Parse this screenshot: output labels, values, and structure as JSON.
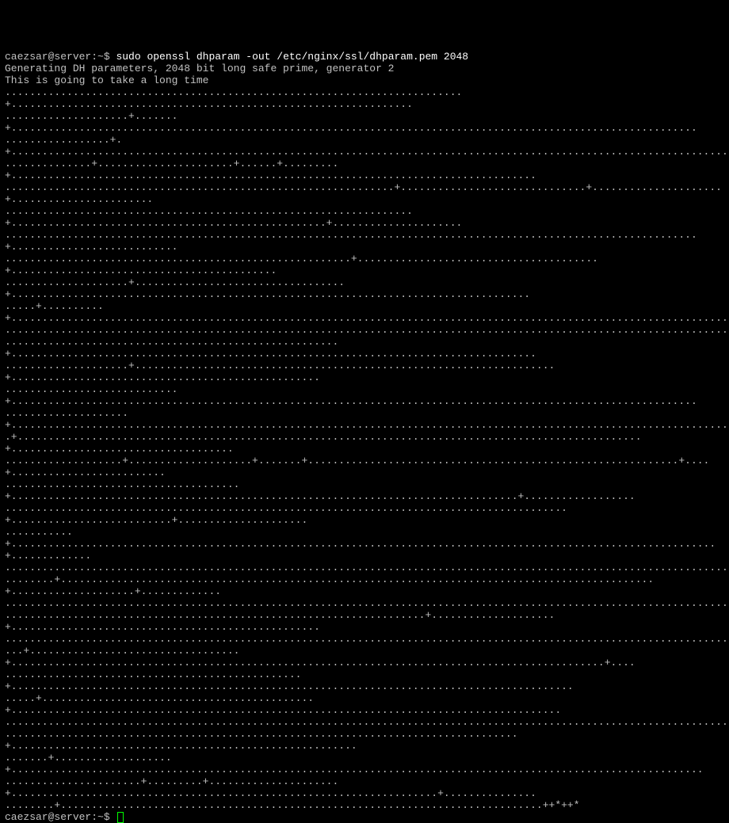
{
  "line1": {
    "prompt": "caezsar@server:~$ ",
    "cmd": "sudo openssl dhparam -out /etc/nginx/ssl/dhparam.pem 2048"
  },
  "line2": "Generating DH parameters, 2048 bit long safe prime, generator 2",
  "line3": "This is going to take a long time",
  "progress_lines": [
    "..........................................................................+.................................................................",
    "....................+.......+...............................................................................................................",
    ".................+.+........................................................................................................................",
    "..............+......................+......+.........+.....................................................................................",
    "...............................................................+..............................+.....................+.......................",
    "..................................................................+...................................................+.....................",
    "................................................................................................................+...........................",
    "........................................................+.......................................+...........................................",
    "....................+..................................+....................................................................................",
    ".....+..........+...........................................................................................................................",
    "............................................................................................................................................",
    "......................................................+.....................................................................................",
    "....................+....................................................................+..................................................",
    "............................+...............................................................................................................",
    "....................+.......................................................................................................................",
    ".+.....................................................................................................+....................................",
    "...................+....................+.......+............................................................+....+.........................",
    "......................................+..................................................................................+..................",
    "...........................................................................................+..........................+.....................",
    "...........+..................................................................................................................+.............",
    "............................................................................................................................................",
    "........+................................................................................................+....................+.............",
    "............................................................................................................................................",
    "....................................................................+....................+..................................................",
    "............................................................................................................................................",
    "...+..................................+................................................................................................+....",
    "................................................+...........................................................................................",
    ".....+............................................+.........................................................................................",
    "............................................................................................................................................",
    "...................................................................................+........................................................",
    ".......+...................+................................................................................................................",
    "......................+.........+.....................+.....................................................................+...............",
    "........+..............................................................................++*++*"
  ],
  "line_end": {
    "prompt": "caezsar@server:~$ "
  }
}
